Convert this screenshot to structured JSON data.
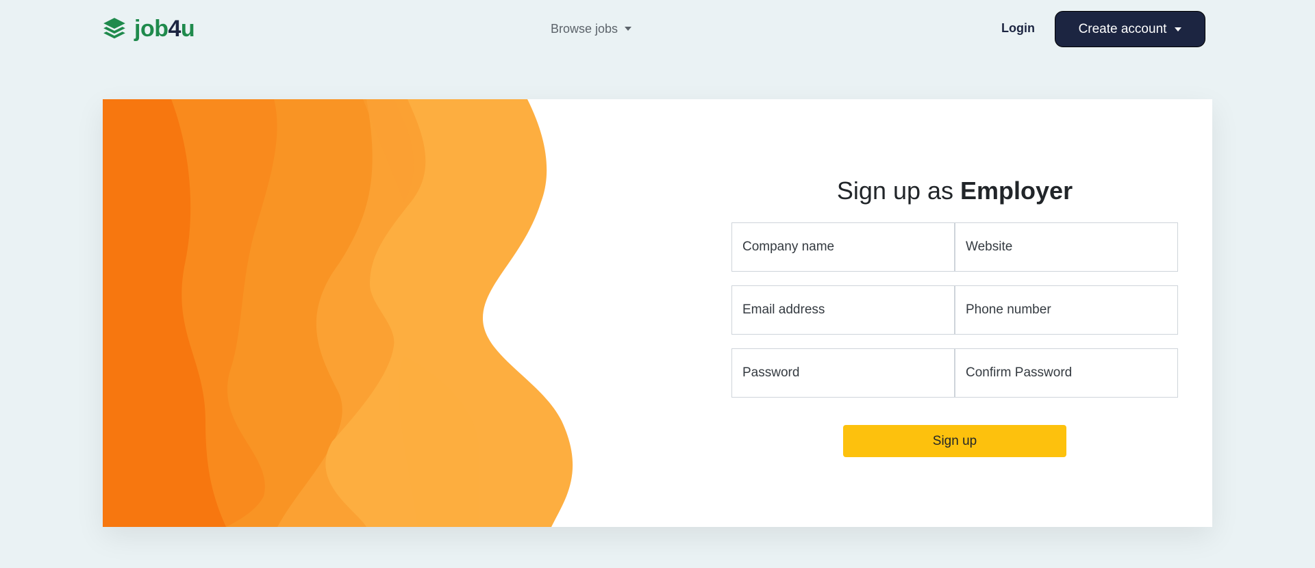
{
  "brand": {
    "name_part1": "job",
    "name_part2": "4",
    "name_part3": "u",
    "icon": "layers-icon",
    "colors": {
      "green": "#1f8a4c",
      "navy": "#1c2541"
    }
  },
  "nav": {
    "browse_label": "Browse jobs",
    "login_label": "Login",
    "create_account_label": "Create account"
  },
  "signup": {
    "title_prefix": "Sign up as ",
    "title_role": "Employer",
    "fields": {
      "company_name": "Company name",
      "website": "Website",
      "email": "Email address",
      "phone": "Phone number",
      "password": "Password",
      "confirm_password": "Confirm Password"
    },
    "submit_label": "Sign up"
  },
  "colors": {
    "background": "#eaf2f4",
    "accent_yellow": "#fdc10d",
    "orange_1": "#f7770f",
    "orange_2": "#f98a1d",
    "orange_3": "#f99424",
    "orange_4": "#fba133",
    "orange_5": "#fdae40"
  }
}
